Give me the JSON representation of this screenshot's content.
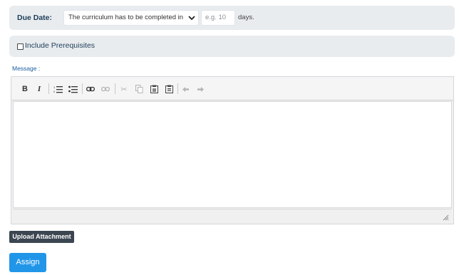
{
  "due_date": {
    "label": "Due Date:",
    "select_value": "The curriculum has to be completed in",
    "days_placeholder": "e.g. 10",
    "days_suffix": "days."
  },
  "prerequisites": {
    "label": "Include Prerequisites",
    "checked": false
  },
  "message": {
    "label": "Message :",
    "toolbar": [
      {
        "name": "bold-icon",
        "glyph": "B"
      },
      {
        "name": "italic-icon",
        "glyph": "I"
      },
      {
        "name": "numbered-list-icon",
        "glyph": "≡"
      },
      {
        "name": "bulleted-list-icon",
        "glyph": "≡"
      },
      {
        "name": "link-icon",
        "glyph": "⊝"
      },
      {
        "name": "unlink-icon",
        "glyph": "⊝"
      },
      {
        "name": "cut-icon",
        "glyph": "✂"
      },
      {
        "name": "copy-icon",
        "glyph": "⎘"
      },
      {
        "name": "paste-icon",
        "glyph": "▣"
      },
      {
        "name": "paste-text-icon",
        "glyph": "▣"
      },
      {
        "name": "undo-icon",
        "glyph": "↶"
      },
      {
        "name": "redo-icon",
        "glyph": "↷"
      }
    ]
  },
  "upload_button": "Upload Attachment",
  "assign_button": "Assign",
  "colors": {
    "panel_bg": "#e9ecef",
    "label_text": "#1d3d59",
    "assign_bg": "#2196e9",
    "upload_bg": "#3c4650"
  }
}
